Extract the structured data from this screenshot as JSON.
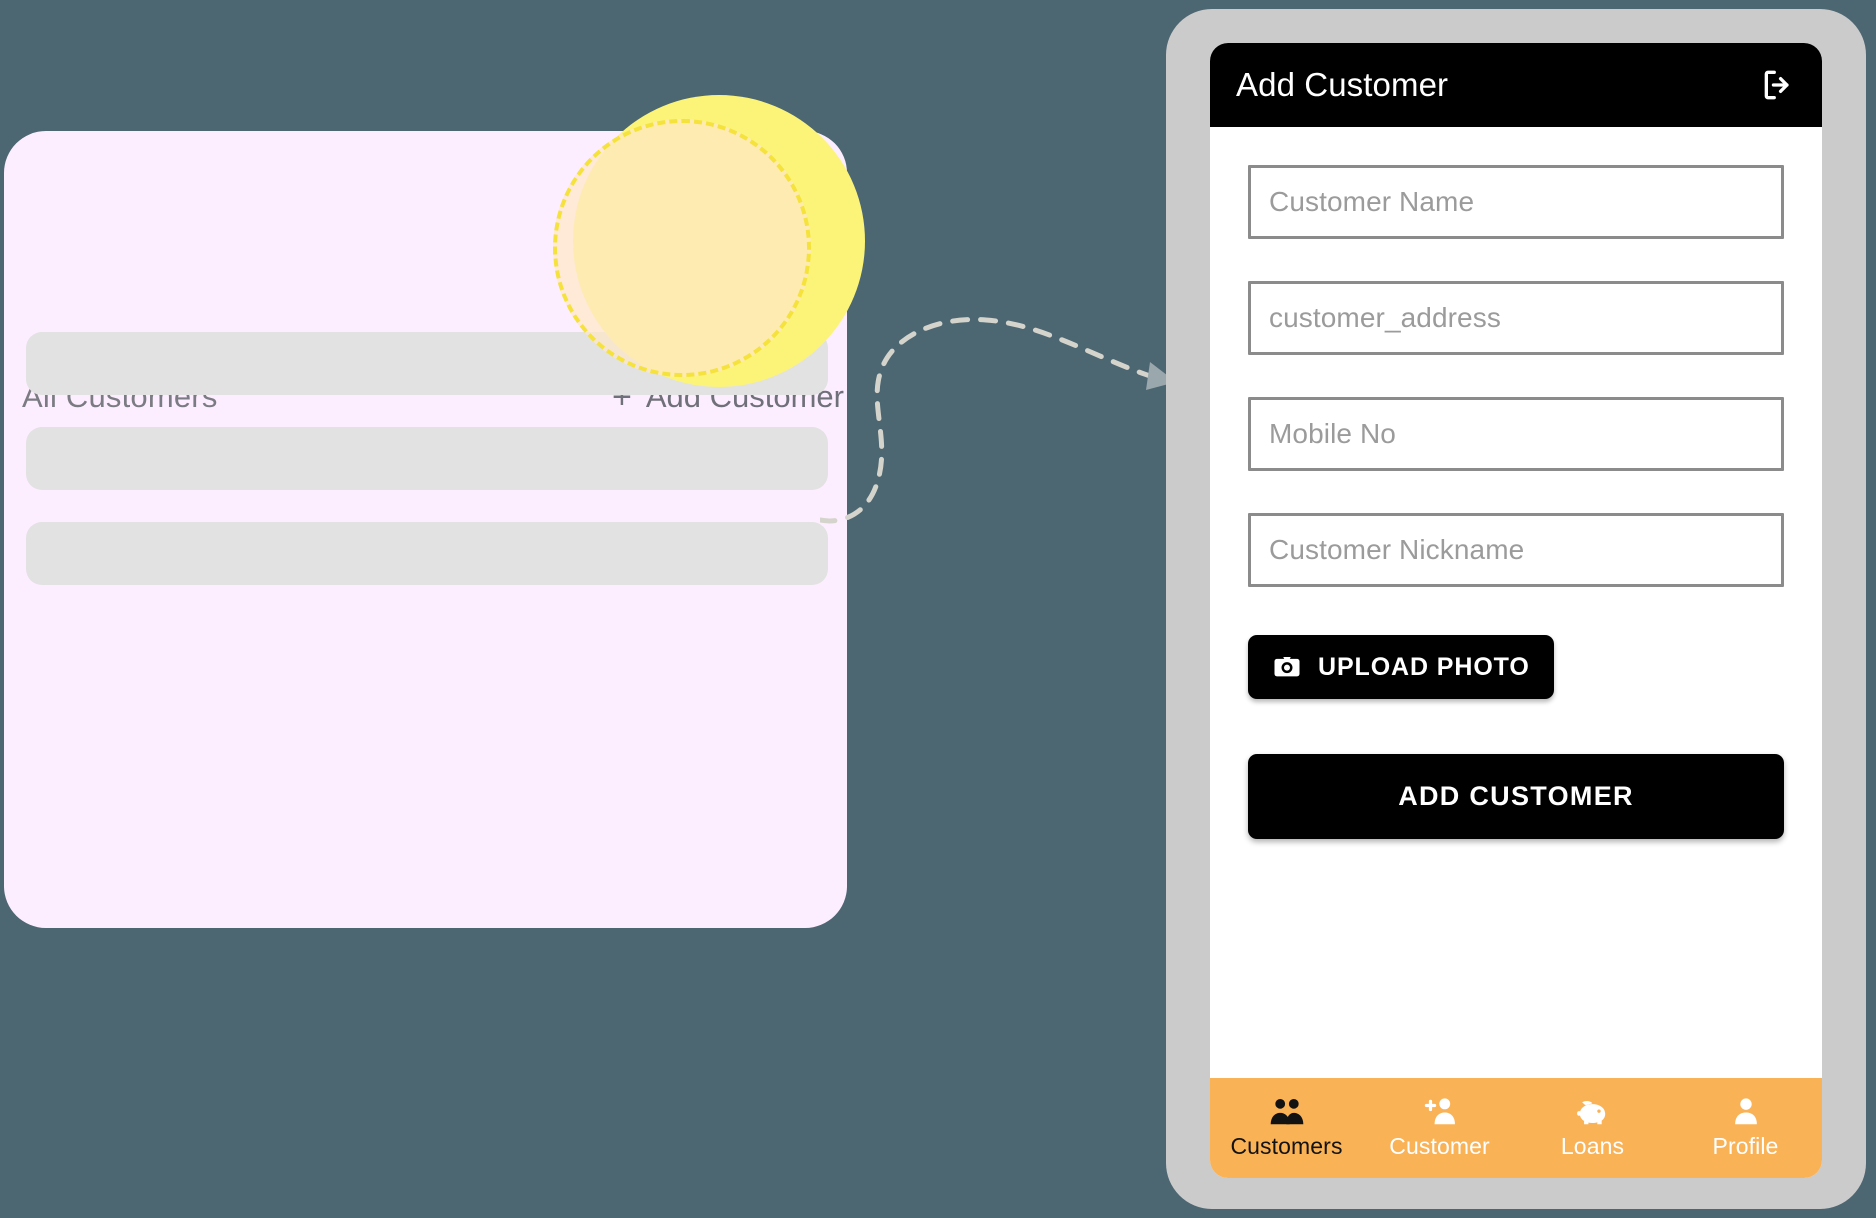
{
  "colors": {
    "page_background": "#4c6672",
    "panel_background": "#fdeeff",
    "skeleton_row": "#e2e2e2",
    "highlight_glow": "#fbf479",
    "highlight_ring_border": "#f5e23c",
    "highlight_ring_fill": "#ffe8c8",
    "phone_frame": "#cbcbcb",
    "header_background": "#000000",
    "accent_orange": "#f9b256",
    "field_border": "#8b8b8b",
    "placeholder_text": "#9b9b9b",
    "connector_dash": "#d4d4cc"
  },
  "left_panel": {
    "title": "All Customers",
    "add_customer_label": "Add Customer",
    "plus_glyph": "+",
    "skeleton_row_count": 3
  },
  "phone": {
    "header": {
      "title": "Add Customer",
      "logout_icon": "logout-icon"
    },
    "form": {
      "fields": [
        {
          "name": "customer-name-field",
          "placeholder": "Customer Name"
        },
        {
          "name": "customer-address-field",
          "placeholder": "customer_address"
        },
        {
          "name": "mobile-no-field",
          "placeholder": "Mobile No"
        },
        {
          "name": "customer-nickname-field",
          "placeholder": "Customer Nickname"
        }
      ],
      "upload_photo_label": "UPLOAD PHOTO",
      "upload_photo_icon": "camera-icon",
      "submit_label": "ADD CUSTOMER"
    },
    "bottom_nav": [
      {
        "label": "Customers",
        "icon": "people-group-icon",
        "active": true
      },
      {
        "label": "Customer",
        "icon": "person-add-icon",
        "active": false
      },
      {
        "label": "Loans",
        "icon": "piggy-bank-icon",
        "active": false
      },
      {
        "label": "Profile",
        "icon": "person-icon",
        "active": false
      }
    ]
  },
  "connector": {
    "type": "dashed-curved-arrow",
    "direction": "left-to-right"
  }
}
